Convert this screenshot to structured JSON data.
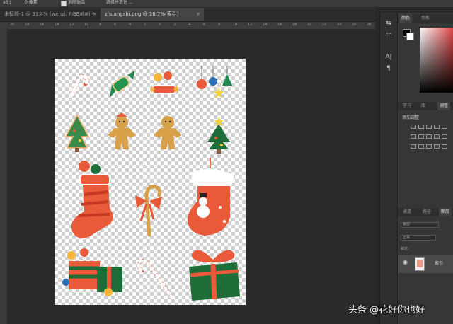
{
  "options_bar": {
    "items": [
      "a5 t",
      "0 像素",
      "消除锯齿",
      "选择并遮住 ..."
    ]
  },
  "tabs": [
    {
      "label": "未标题-1 @ 31.8% (wenzi, RGB/8#) *",
      "close": "×",
      "active": false
    },
    {
      "label": "zhuangshi.png @ 16.7%(索引)",
      "close": "×",
      "active": true
    }
  ],
  "ruler": {
    "ticks": [
      "20",
      "18",
      "16",
      "14",
      "12",
      "10",
      "8",
      "6",
      "4",
      "2",
      "0",
      "2",
      "4",
      "6",
      "8",
      "10",
      "12",
      "14",
      "16",
      "18",
      "20",
      "22",
      "24",
      "26",
      "28"
    ]
  },
  "tools": [
    {
      "icon": "doc-arrow-icon",
      "glyph": "⇆"
    },
    {
      "icon": "brush-preset-icon",
      "glyph": "☷"
    },
    {
      "icon": "clone-icon",
      "glyph": "❐"
    },
    {
      "icon": "character-icon",
      "glyph": "A|"
    },
    {
      "icon": "paragraph-icon",
      "glyph": "¶"
    }
  ],
  "color_panel": {
    "tabs": [
      "颜色",
      "色板"
    ],
    "foreground": "#000000",
    "background": "#ffffff"
  },
  "adjust_panel": {
    "tabs": [
      "学习",
      "库",
      "调整"
    ],
    "title": "添加调整"
  },
  "layers_panel": {
    "tabs": [
      "通道",
      "路径",
      "图层"
    ],
    "search_placeholder": "类型",
    "blend_mode": "正常",
    "lock_label": "锁定:",
    "layer_name": "索引"
  },
  "watermark": "头条 @花好你也好"
}
